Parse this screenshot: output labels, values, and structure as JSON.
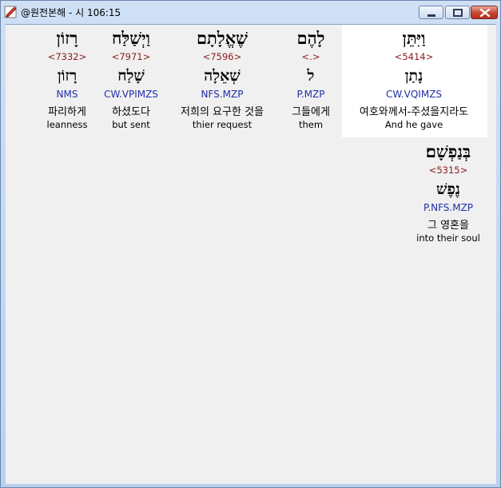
{
  "window": {
    "title": "@원전본해 - 시 106:15"
  },
  "row1": [
    {
      "id": "w1",
      "surface": "וַיִּתֵּן",
      "strong": "<5414>",
      "lemma": "נָתַן",
      "morph": "CW.VQIMZS",
      "korean": "여호와께서-주셨을지라도",
      "english": "And he gave"
    },
    {
      "id": "w2",
      "surface": "לָהֶם",
      "strong": "<.>",
      "lemma": "ל",
      "morph": "P.MZP",
      "korean": "그들에게",
      "english": "them"
    },
    {
      "id": "w3",
      "surface": "שֶׁאֱלָתָם",
      "strong": "<7596>",
      "lemma": "שְׁאֵלָה",
      "morph": "NFS.MZP",
      "korean": "저희의 요구한 것을",
      "english": "thier request"
    },
    {
      "id": "w4",
      "surface": "וַיְשַׁלַּח",
      "strong": "<7971>",
      "lemma": "שָׁלַח",
      "morph": "CW.VPIMZS",
      "korean": "하셨도다",
      "english": "but sent"
    },
    {
      "id": "w5",
      "surface": "רָזוֹן",
      "strong": "<7332>",
      "lemma": "רָזוֹן",
      "morph": "NMS",
      "korean": "파리하게",
      "english": "leanness"
    }
  ],
  "row2": [
    {
      "id": "w6",
      "surface": "בְּנַפְשָׁם׃",
      "strong": "<5315>",
      "lemma": "נֶפֶשׁ",
      "morph": "P.NFS.MZP",
      "korean": "그 영혼을",
      "english": "into their soul"
    }
  ]
}
